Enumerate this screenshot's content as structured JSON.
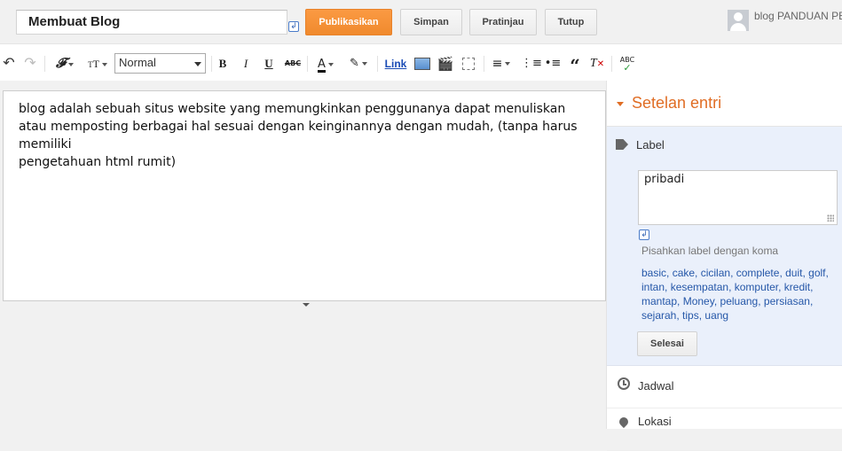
{
  "header": {
    "post_title": "Membuat Blog",
    "publish_label": "Publikasikan",
    "save_label": "Simpan",
    "preview_label": "Pratinjau",
    "close_label": "Tutup",
    "blog_name": "blog PANDUAN PE",
    "accent_color": "#f08a2d"
  },
  "toolbar": {
    "font_size_label": "Normal",
    "link_label": "Link"
  },
  "editor": {
    "lines": [
      "blog adalah sebuah situs website yang memungkinkan penggunanya dapat menuliskan",
      "atau memposting berbagai hal sesuai dengan keinginannya dengan mudah, (tanpa harus memiliki",
      "pengetahuan html rumit)"
    ]
  },
  "sidebar": {
    "title": "Setelan entri",
    "label_section": "Label",
    "label_value": "pribadi",
    "hint": "Pisahkan label dengan koma",
    "tags": [
      "basic",
      "cake",
      "cicilan",
      "complete",
      "duit",
      "golf",
      "intan",
      "kesempatan",
      "komputer",
      "kredit",
      "mantap",
      "Money",
      "peluang",
      "persiasan",
      "sejarah",
      "tips",
      "uang"
    ],
    "done_label": "Selesai",
    "schedule_label": "Jadwal",
    "location_label": "Lokasi"
  }
}
